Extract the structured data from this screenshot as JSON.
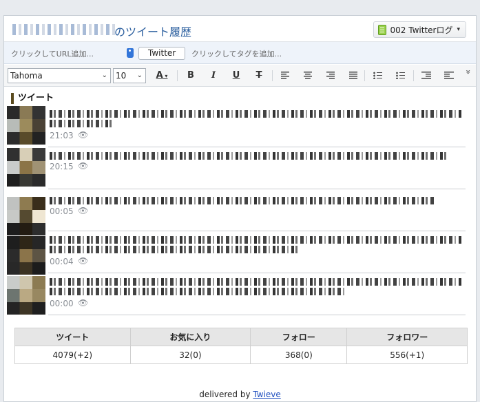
{
  "header": {
    "title_suffix": "のツイート履歴",
    "notebook_label": "002 Twitterログ",
    "notebook_caret": "▾"
  },
  "tag_row": {
    "url_add": "クリックしてURL追加...",
    "tag": "Twitter",
    "tag_add": "クリックしてタグを追加..."
  },
  "toolbar": {
    "font": "Tahoma",
    "size": "10",
    "font_color": "A",
    "bold": "B",
    "italic": "I",
    "underline": "U",
    "strike": "T",
    "more": "»"
  },
  "section_title": "ツイート",
  "tweets": [
    {
      "time": "21:03"
    },
    {
      "time": "20:15"
    },
    {
      "time": "00:05"
    },
    {
      "time": "00:04"
    },
    {
      "time": "00:00"
    }
  ],
  "stats": {
    "headers": [
      "ツイート",
      "お気に入り",
      "フォロー",
      "フォロワー"
    ],
    "values": [
      "4079(+2)",
      "32(0)",
      "368(0)",
      "556(+1)"
    ]
  },
  "footer": {
    "prefix": "delivered by",
    "link": "Twieve"
  }
}
